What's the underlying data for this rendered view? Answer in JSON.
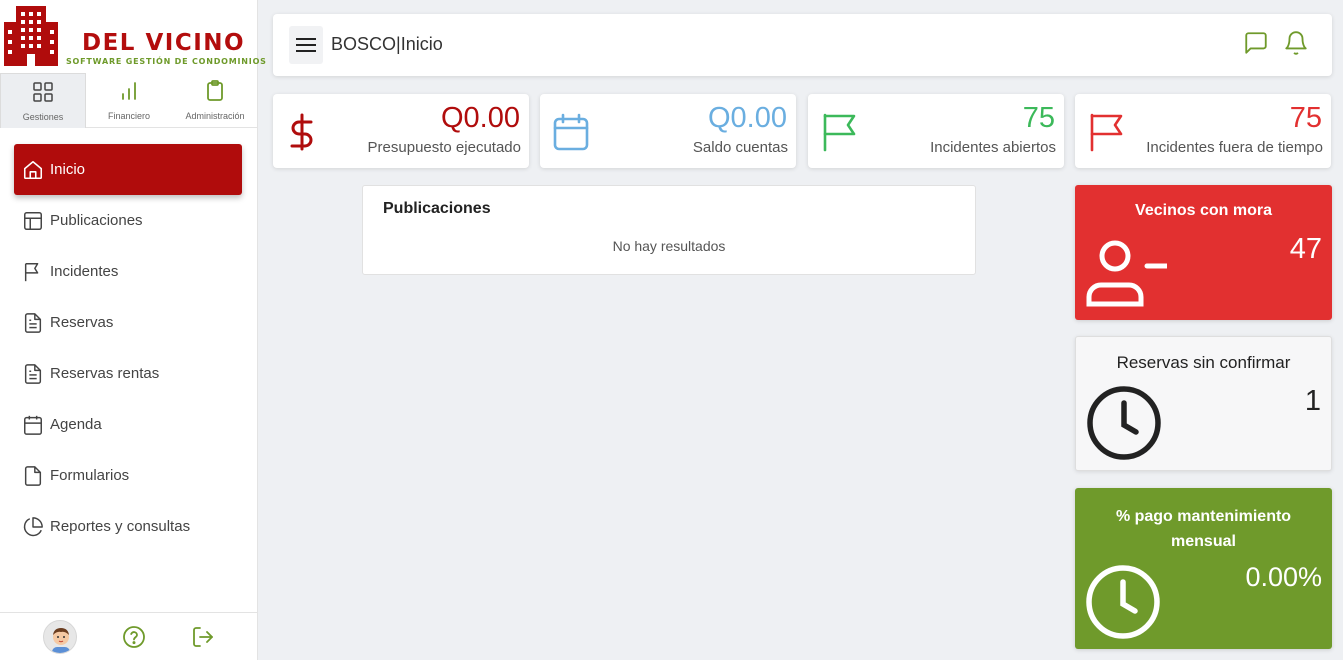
{
  "brand": {
    "name": "DEL VICINO",
    "tagline": "SOFTWARE GESTIÓN DE CONDOMINIOS",
    "primary_color": "#b00c0c",
    "secondary_color": "#6f9a2b"
  },
  "modules": [
    {
      "label": "Gestiones",
      "icon": "grid-icon",
      "active": true
    },
    {
      "label": "Financiero",
      "icon": "bar-chart-icon",
      "active": false
    },
    {
      "label": "Administración",
      "icon": "clipboard-icon",
      "active": false
    }
  ],
  "nav": [
    {
      "label": "Inicio",
      "icon": "home-icon",
      "active": true
    },
    {
      "label": "Publicaciones",
      "icon": "layout-icon"
    },
    {
      "label": "Incidentes",
      "icon": "flag-icon"
    },
    {
      "label": "Reservas",
      "icon": "document-icon"
    },
    {
      "label": "Reservas rentas",
      "icon": "document-icon"
    },
    {
      "label": "Agenda",
      "icon": "calendar-icon"
    },
    {
      "label": "Formularios",
      "icon": "file-icon"
    },
    {
      "label": "Reportes y consultas",
      "icon": "pie-chart-icon"
    }
  ],
  "footer": {
    "icons": [
      "avatar",
      "help-icon",
      "logout-icon"
    ]
  },
  "header": {
    "title": "BOSCO|Inicio",
    "icons": [
      "menu-icon",
      "chat-icon",
      "bell-icon"
    ]
  },
  "kpis": [
    {
      "value": "Q0.00",
      "label": "Presupuesto ejecutado",
      "color": "#b00c0c",
      "icon": "dollar-icon"
    },
    {
      "value": "Q0.00",
      "label": "Saldo cuentas",
      "color": "#6aaee0",
      "icon": "calendar-icon"
    },
    {
      "value": "75",
      "label": "Incidentes abiertos",
      "color": "#3cb95a",
      "icon": "flag-icon"
    },
    {
      "value": "75",
      "label": "Incidentes fuera de tiempo",
      "color": "#e23030",
      "icon": "flag-icon"
    }
  ],
  "publicaciones": {
    "title": "Publicaciones",
    "empty_text": "No hay resultados"
  },
  "stats": {
    "mora": {
      "title": "Vecinos con mora",
      "value": "47",
      "color": "#e23030",
      "icon": "user-minus-icon"
    },
    "reservas": {
      "title": "Reservas sin confirmar",
      "value": "1",
      "color": "#f7f7f8",
      "icon": "clock-icon"
    },
    "pago": {
      "title": "% pago mantenimiento mensual",
      "value": "0.00%",
      "color": "#6f9a2b",
      "icon": "clock-icon"
    }
  }
}
